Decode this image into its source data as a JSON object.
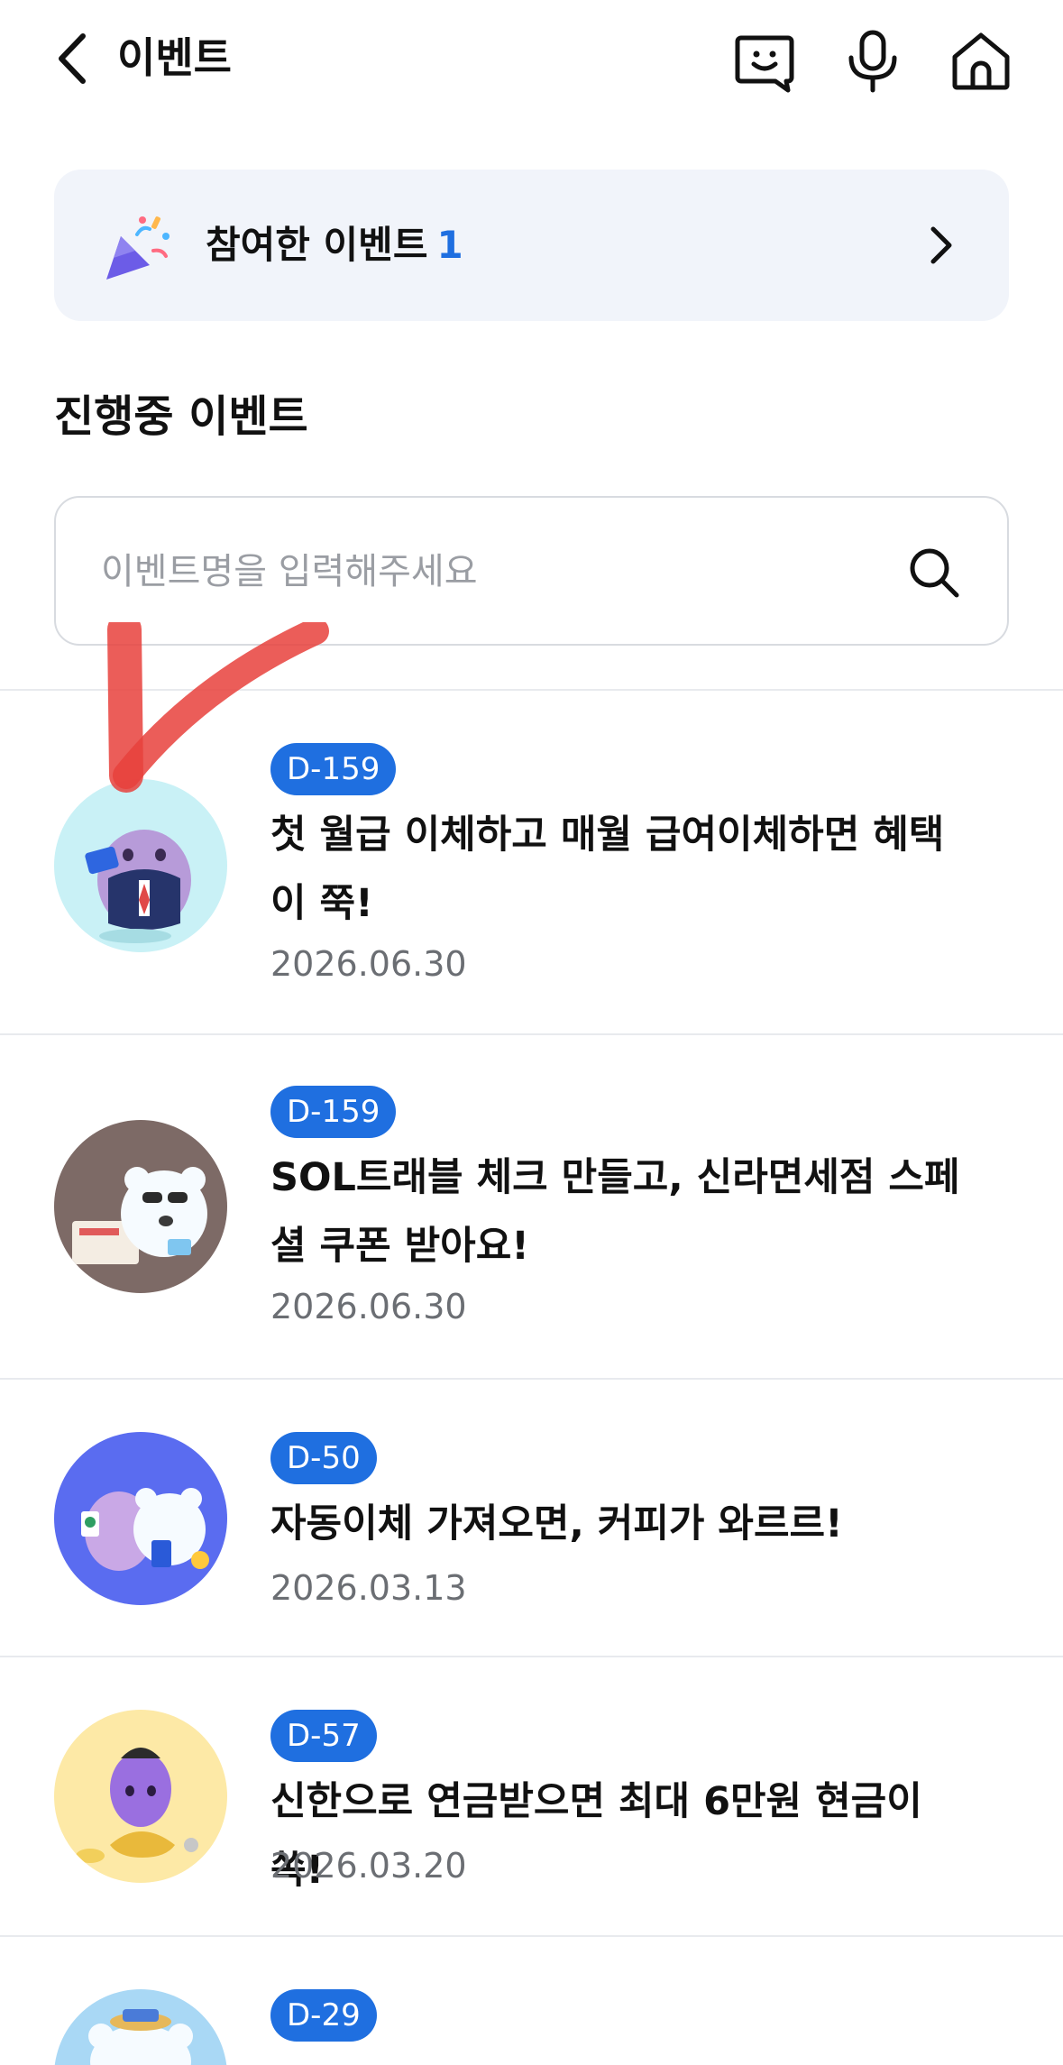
{
  "header": {
    "title": "이벤트"
  },
  "banner": {
    "label": "참여한 이벤트",
    "count": "1"
  },
  "section": {
    "title": "진행중 이벤트"
  },
  "search": {
    "placeholder": "이벤트명을 입력해주세요"
  },
  "events": [
    {
      "badge": "D-159",
      "title": "첫 월급 이체하고 매월 급여이체하면 혜택이 쭉!",
      "date": "2026.06.30",
      "thumb_bg": "#c9f1f6"
    },
    {
      "badge": "D-159",
      "title": "SOL트래블 체크 만들고, 신라면세점 스페셜 쿠폰 받아요!",
      "date": "2026.06.30",
      "thumb_bg": "#7d6a66"
    },
    {
      "badge": "D-50",
      "title": "자동이체 가져오면, 커피가 와르르!",
      "date": "2026.03.13",
      "thumb_bg": "#5a6cf0"
    },
    {
      "badge": "D-57",
      "title": "신한으로 연금받으면 최대 6만원 현금이 쏙!",
      "date": "2026.03.20",
      "thumb_bg": "#fde9a6"
    },
    {
      "badge": "D-29",
      "title": "",
      "date": "",
      "thumb_bg": "#a9d8f5"
    }
  ],
  "colors": {
    "accent": "#1f6fe0",
    "banner_bg": "#f1f4fa",
    "annotation": "#e8413c"
  }
}
